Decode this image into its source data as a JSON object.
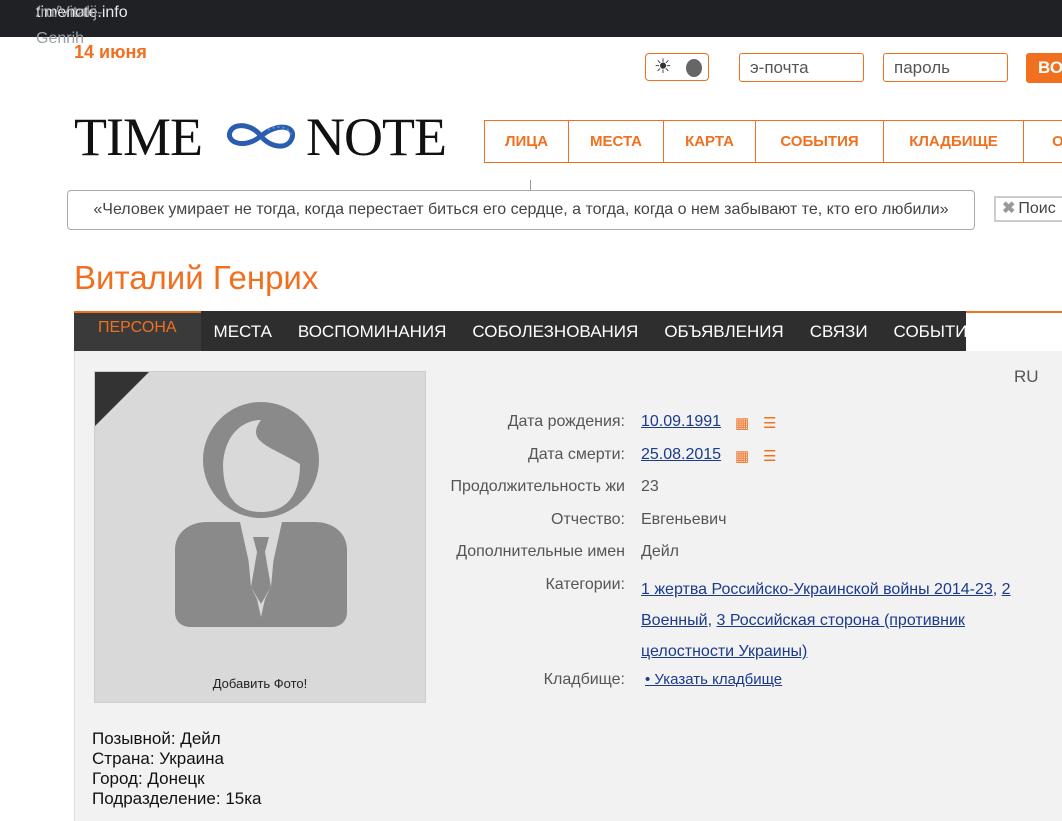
{
  "browser": {
    "url_host": "timenote.info",
    "url_path": "/ru/Vitalij-Genrih"
  },
  "header": {
    "date": "14 июня",
    "email_placeholder": "э-почта",
    "password_placeholder": "пароль",
    "login_label": "ВО",
    "logo_left": "TIME",
    "logo_right": "NOTE"
  },
  "nav": [
    "ЛИЦА",
    "МЕСТА",
    "КАРТА",
    "СОБЫТИЯ",
    "КЛАДБИЩЕ",
    "О"
  ],
  "quote": "«Человек умирает не тогда, когда перестает биться его сердце, а тогда, когда о нем забывают те, кто его любили»",
  "search_label": "Поис",
  "person": {
    "name": "Виталий Генрих"
  },
  "tabs": [
    "ПЕРСОНА",
    "МЕСТА",
    "ВОСПОМИНАНИЯ",
    "СОБОЛЕЗНОВАНИЯ",
    "ОБЪЯВЛЕНИЯ",
    "СВЯЗИ",
    "СОБЫТИЯ"
  ],
  "lang": "RU",
  "photo": {
    "add_label": "Добавить Фото!"
  },
  "details": {
    "birth_label": "Дата рождения:",
    "birth_value": "10.09.1991",
    "death_label": "Дата смерти:",
    "death_value": "25.08.2015",
    "duration_label": "Продолжительность жи",
    "duration_value": "23",
    "patronymic_label": "Отчество:",
    "patronymic_value": "Евгеньевич",
    "extra_names_label": "Дополнительные имен",
    "extra_names_value": "Дейл",
    "categories_label": "Категории:",
    "categories": [
      "1 жертва Российско-Украинской войны 2014-23",
      "2 Военный",
      "3 Российская сторона (противник целостности Украины)"
    ],
    "cemetery_label": "Кладбище:",
    "cemetery_value": "• Указать кладбище"
  },
  "bio": [
    "Позывной: Дейл",
    "Страна: Украина",
    "Город: Донецк",
    "Подразделение: 15ка"
  ],
  "colors": {
    "accent": "#f07020",
    "link": "#1a3a8a",
    "tabbar": "#2e2e2e"
  }
}
